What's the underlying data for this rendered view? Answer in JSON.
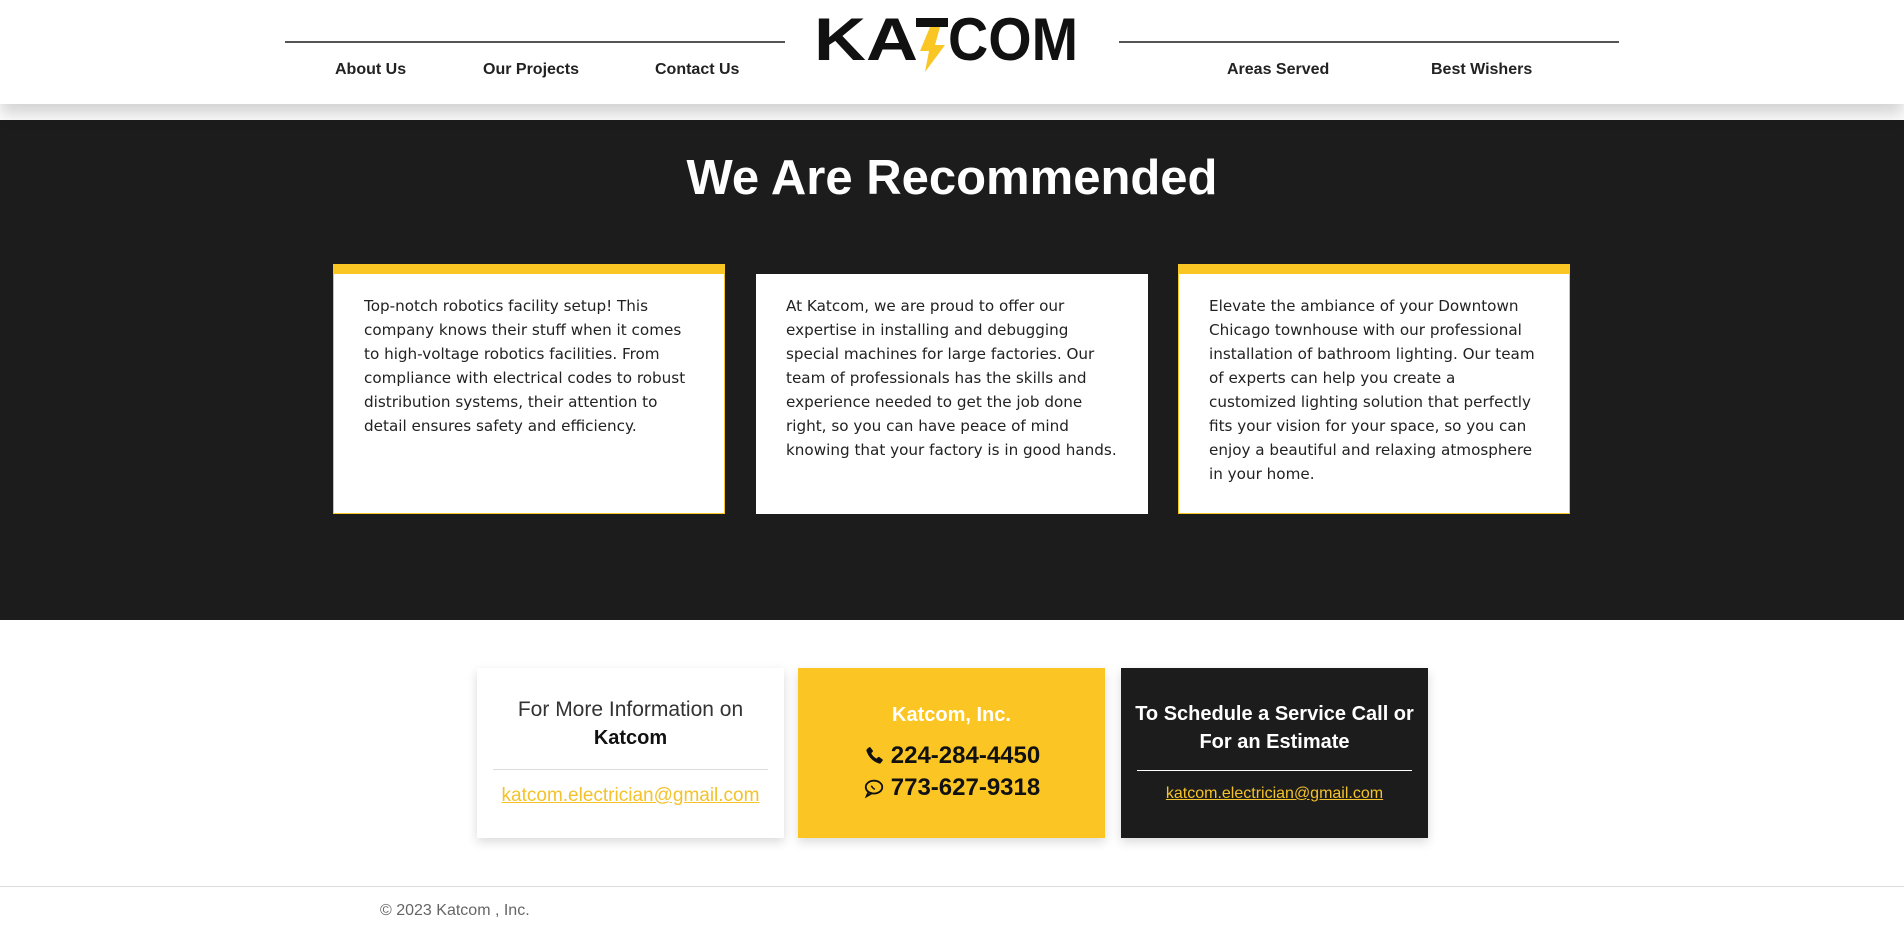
{
  "header": {
    "logo_text": "KATCOM",
    "nav_left": [
      "About Us",
      "Our Projects",
      "Contact Us"
    ],
    "nav_right": [
      "Areas Served",
      "Best Wishers"
    ]
  },
  "recommended": {
    "title": "We Are Recommended",
    "cards": [
      {
        "text": "Top-notch robotics facility setup! This company knows their stuff when it comes to high-voltage robotics facilities. From compliance with electrical codes to robust distribution systems, their attention to detail ensures safety and efficiency."
      },
      {
        "text": "At Katcom, we are proud to offer our expertise in installing and debugging special machines for large factories. Our team of professionals has the skills and experience needed to get the job done right, so you can have peace of mind knowing that your factory is in good hands."
      },
      {
        "text": "Elevate the ambiance of your Downtown Chicago townhouse with our professional installation of bathroom lighting. Our team of experts can help you create a customized lighting solution that perfectly fits your vision for your space, so you can enjoy a beautiful and relaxing atmosphere in your home."
      }
    ]
  },
  "contact": {
    "info_line1": "For More Information on",
    "info_line2": "Katcom",
    "email": "katcom.electrician@gmail.com",
    "company": "Katcom, Inc.",
    "phone1": "224-284-4450",
    "phone2": "773-627-9318",
    "phone1_icon": "phone-icon",
    "phone2_icon": "chat-icon",
    "schedule_title": "To Schedule a Service Call or For an Estimate",
    "schedule_email": "katcom.electrician@gmail.com"
  },
  "footer": {
    "copyright": "© 2023 Katcom , Inc."
  },
  "colors": {
    "accent": "#fbc623",
    "dark": "#1c1c1c"
  }
}
